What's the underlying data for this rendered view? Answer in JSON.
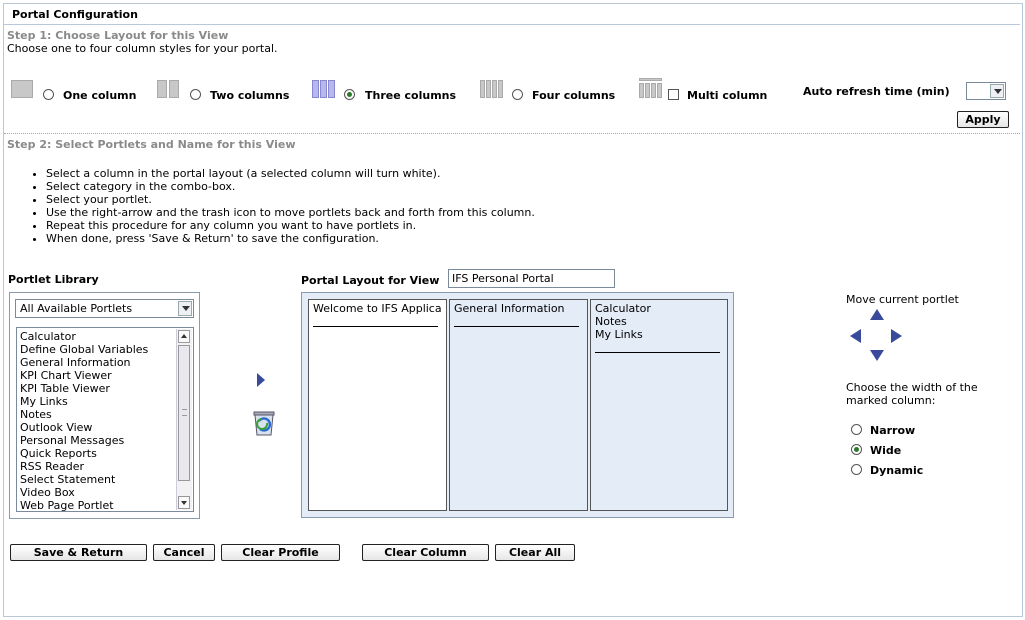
{
  "title": "Portal Configuration",
  "step1": {
    "heading": "Step 1: Choose Layout for this View",
    "description": "Choose one to four column styles for your portal.",
    "options": [
      {
        "label": "One column",
        "selected": false
      },
      {
        "label": "Two columns",
        "selected": false
      },
      {
        "label": "Three columns",
        "selected": true
      },
      {
        "label": "Four columns",
        "selected": false
      },
      {
        "label": "Multi column",
        "checked": false
      }
    ],
    "auto_refresh_label": "Auto refresh time (min)",
    "auto_refresh_value": "",
    "apply_label": "Apply"
  },
  "step2": {
    "heading": "Step 2: Select Portlets and Name for this View",
    "instructions": [
      "Select a column in the portal layout (a selected column will turn white).",
      "Select category in the combo-box.",
      "Select your portlet.",
      "Use the right-arrow and the trash icon to move portlets back and forth from this column.",
      "Repeat this procedure for any column you want to have portlets in.",
      "When done, press 'Save & Return' to save the configuration."
    ]
  },
  "library": {
    "label": "Portlet Library",
    "category": "All Available Portlets",
    "items": [
      "Calculator",
      "Define Global Variables",
      "General Information",
      "KPI Chart Viewer",
      "KPI Table Viewer",
      "My Links",
      "Notes",
      "Outlook View",
      "Personal Messages",
      "Quick Reports",
      "RSS Reader",
      "Select Statement",
      "Video Box",
      "Web Page Portlet"
    ]
  },
  "layout": {
    "label": "Portal Layout for View",
    "view_name": "IFS Personal Portal",
    "columns": [
      {
        "items": [
          "Welcome to IFS Applica"
        ]
      },
      {
        "items": [
          "General Information"
        ]
      },
      {
        "items": [
          "Calculator",
          "Notes",
          "My Links"
        ]
      }
    ]
  },
  "move": {
    "label": "Move current portlet"
  },
  "width": {
    "label_line1": "Choose the width of the",
    "label_line2": "marked column:",
    "options": [
      {
        "label": "Narrow",
        "selected": false
      },
      {
        "label": "Wide",
        "selected": true
      },
      {
        "label": "Dynamic",
        "selected": false
      }
    ]
  },
  "buttons": {
    "save": "Save & Return",
    "cancel": "Cancel",
    "clear_profile": "Clear Profile",
    "clear_column": "Clear Column",
    "clear_all": "Clear All"
  },
  "colors": {
    "column_bg": "#e4ecf8",
    "selected_column_bg": "#ffffff",
    "layout_icon_selected": "#b8b8f0",
    "arrow": "#3a4a9a"
  }
}
